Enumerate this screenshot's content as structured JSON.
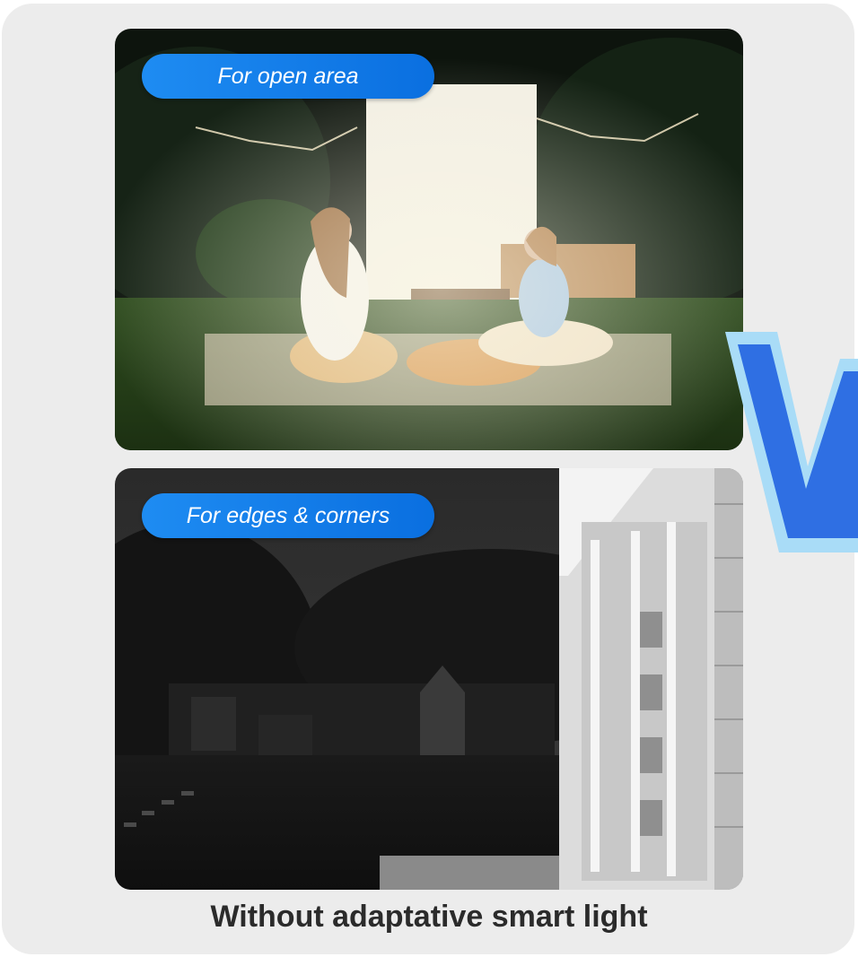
{
  "panels": [
    {
      "label": "For open area",
      "scene": "night-backyard-picnic-lit"
    },
    {
      "label": "For edges & corners",
      "scene": "night-house-corner-grayscale"
    }
  ],
  "caption": "Without adaptative smart light",
  "colors": {
    "pill": "#1e8cf2",
    "card_background": "#ececec",
    "caption_text": "#2b2b2b",
    "v_mark": "#2f6fe3"
  }
}
